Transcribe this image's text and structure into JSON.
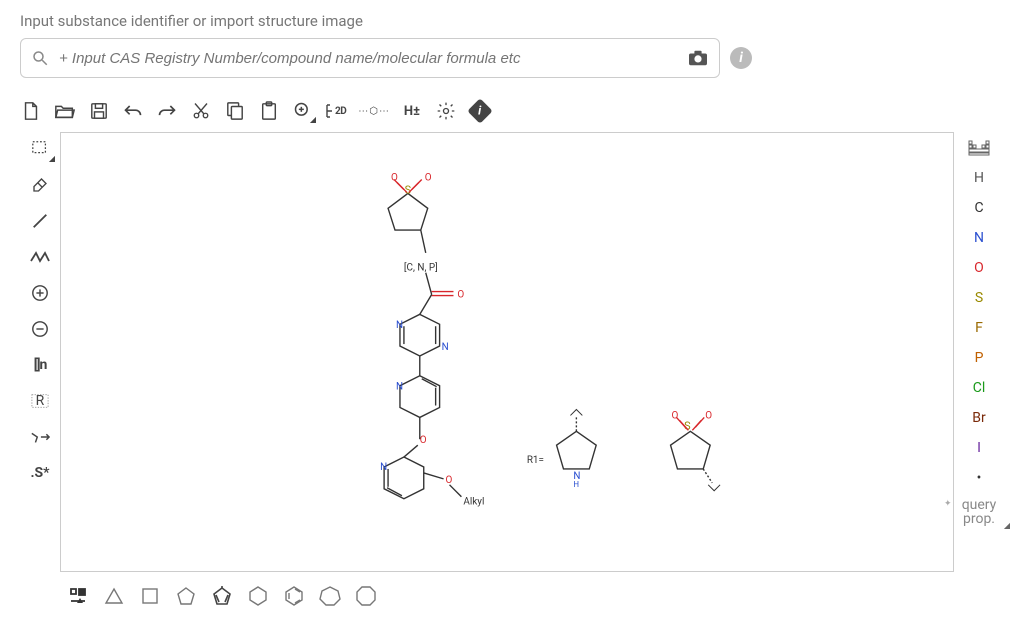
{
  "heading": "Input substance identifier or import structure image",
  "search": {
    "placeholder": "+ Input CAS Registry Number/compound name/molecular formula etc",
    "value": ""
  },
  "top_toolbar": {
    "new": "New",
    "open": "Open",
    "save": "Save",
    "undo": "Undo",
    "redo": "Redo",
    "cut": "Cut",
    "copy": "Copy",
    "paste": "Paste",
    "zoom_add": "Enlarge",
    "layout_2d": "2D",
    "dearomatize": "Dearomatize",
    "hydrogens": "H±",
    "settings": "Settings",
    "info": "Info"
  },
  "left_toolbar": {
    "select": "Select",
    "erase": "Erase",
    "bond": "Bond",
    "chain": "Chain",
    "charge_plus": "Charge +",
    "charge_minus": "Charge −",
    "brackets": "[]n",
    "rgroup": "R",
    "reaction_arrow": "Reaction Arrow",
    "sgroup": ".S*"
  },
  "right_toolbar": {
    "periodic": "Periodic Table",
    "H": "H",
    "C": "C",
    "N": "N",
    "O": "O",
    "S": "S",
    "F": "F",
    "P": "P",
    "Cl": "Cl",
    "Br": "Br",
    "I": "I",
    "any": "•",
    "query_prop": "query prop."
  },
  "bottom_toolbar": {
    "template_lib": "Template Library",
    "triangle": "Cyclopropane",
    "square": "Cyclobutane",
    "pentagon": "Cyclopentane",
    "cyclopentadiene": "Cyclopentadiene",
    "hexagon": "Cyclohexane",
    "benzene": "Benzene",
    "heptagon": "Cycloheptane",
    "octagon": "Cyclooctane"
  },
  "atom_colors": {
    "H": "#555",
    "C": "#333",
    "N": "#2a4fd0",
    "O": "#d8262b",
    "S": "#9a8a00",
    "F": "#9a6a00",
    "P": "#c06000",
    "Cl": "#1a9a1a",
    "Br": "#7a2a0a",
    "I": "#6a2aa0",
    "any": "#333"
  },
  "canvas": {
    "annotations": {
      "cnp": "[C, N, P]",
      "alkyl": "Alkyl",
      "r1": "R1="
    }
  }
}
